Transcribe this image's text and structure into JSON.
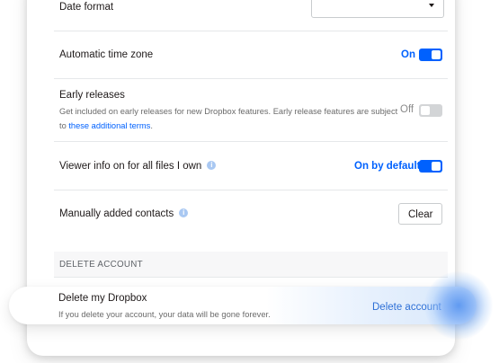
{
  "settings": {
    "date_format": {
      "label": "Date format",
      "value": ""
    },
    "auto_timezone": {
      "label": "Automatic time zone",
      "state": "On"
    },
    "early_releases": {
      "label": "Early releases",
      "desc_line1": "Get included on early releases for new Dropbox features. Early release features are subject",
      "desc_prefix": "to ",
      "desc_link": "these additional terms",
      "desc_suffix": ".",
      "state": "Off"
    },
    "viewer_info": {
      "label": "Viewer info on for all files I own",
      "state": "On by default"
    },
    "contacts": {
      "label": "Manually added contacts",
      "button": "Clear"
    }
  },
  "delete_section": {
    "header": "DELETE ACCOUNT",
    "title": "Delete my Dropbox",
    "description": "If you delete your account, your data will be gone forever.",
    "action": "Delete account"
  },
  "colors": {
    "accent": "#0061fe",
    "link": "#2d6fd6",
    "toggle_off": "#d3d5d7"
  },
  "icons": {
    "info": "info-icon",
    "dropdown": "chevron-down-icon"
  }
}
